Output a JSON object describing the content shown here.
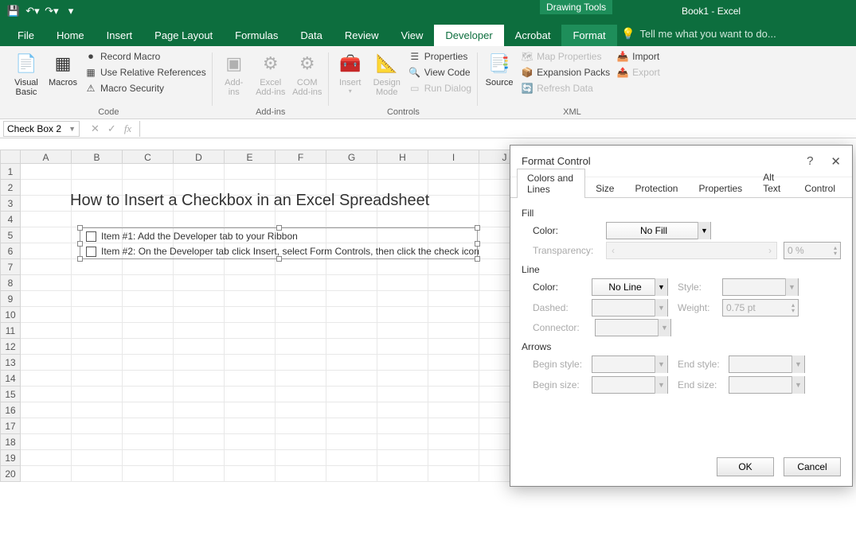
{
  "app": {
    "title": "Book1 - Excel",
    "drawing_tools": "Drawing Tools"
  },
  "tabs": {
    "file": "File",
    "home": "Home",
    "insert": "Insert",
    "page_layout": "Page Layout",
    "formulas": "Formulas",
    "data": "Data",
    "review": "Review",
    "view": "View",
    "developer": "Developer",
    "acrobat": "Acrobat",
    "format": "Format"
  },
  "tellme": "Tell me what you want to do...",
  "ribbon": {
    "code": {
      "vb": "Visual\nBasic",
      "macros": "Macros",
      "record": "Record Macro",
      "relative": "Use Relative References",
      "security": "Macro Security",
      "label": "Code"
    },
    "addins": {
      "addins": "Add-\nins",
      "excel": "Excel\nAdd-ins",
      "com": "COM\nAdd-ins",
      "label": "Add-ins"
    },
    "controls": {
      "insert": "Insert",
      "design": "Design\nMode",
      "props": "Properties",
      "view_code": "View Code",
      "run_dialog": "Run Dialog",
      "label": "Controls"
    },
    "xml": {
      "source": "Source",
      "map_props": "Map Properties",
      "expansion": "Expansion Packs",
      "refresh": "Refresh Data",
      "import": "Import",
      "export": "Export",
      "label": "XML"
    }
  },
  "namebox": "Check Box 2",
  "sheet": {
    "cols": [
      "A",
      "B",
      "C",
      "D",
      "E",
      "F",
      "G",
      "H",
      "I",
      "J"
    ],
    "rows": [
      "1",
      "2",
      "3",
      "4",
      "5",
      "6",
      "7",
      "8",
      "9",
      "10",
      "11",
      "12",
      "13",
      "14",
      "15",
      "16",
      "17",
      "18",
      "19",
      "20"
    ],
    "title": "How to Insert a Checkbox in an Excel Spreadsheet",
    "item1": "Item #1: Add the Developer tab to your Ribbon",
    "item2": "Item #2: On the Developer tab click Insert, select Form Controls, then click the check icon"
  },
  "dialog": {
    "title": "Format Control",
    "tabs": {
      "colors": "Colors and Lines",
      "size": "Size",
      "protection": "Protection",
      "properties": "Properties",
      "alt": "Alt Text",
      "control": "Control"
    },
    "fill": {
      "label": "Fill",
      "color": "Color:",
      "color_val": "No Fill",
      "transparency": "Transparency:",
      "transparency_val": "0 %"
    },
    "line": {
      "label": "Line",
      "color": "Color:",
      "color_val": "No Line",
      "dashed": "Dashed:",
      "connector": "Connector:",
      "style": "Style:",
      "weight": "Weight:",
      "weight_val": "0.75 pt"
    },
    "arrows": {
      "label": "Arrows",
      "begin_style": "Begin style:",
      "end_style": "End style:",
      "begin_size": "Begin size:",
      "end_size": "End size:"
    },
    "ok": "OK",
    "cancel": "Cancel"
  }
}
